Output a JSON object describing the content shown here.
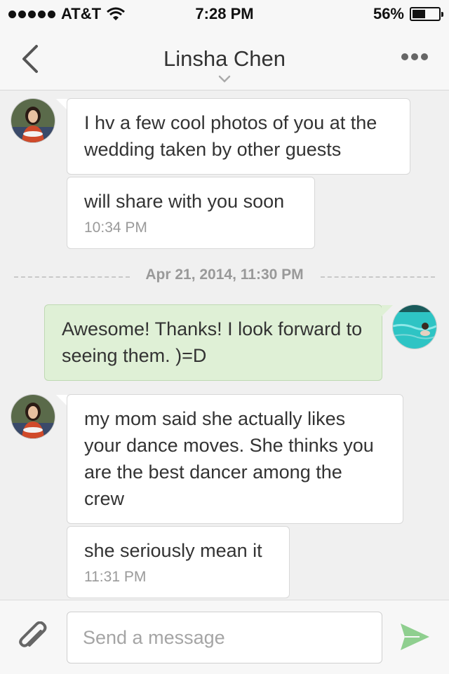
{
  "status_bar": {
    "carrier": "AT&T",
    "time": "7:28 PM",
    "battery_text": "56%",
    "battery_level": 0.56,
    "signal_dots": 5
  },
  "nav": {
    "title": "Linsha Chen",
    "back_icon": "chevron-left-icon",
    "more_icon": "ellipsis-icon",
    "expand_icon": "chevron-down-icon"
  },
  "messages": [
    {
      "direction": "in",
      "text": "I hv a few cool photos of you at the wedding taken by other guests"
    },
    {
      "direction": "in",
      "text": "will share with you soon",
      "time": "10:34 PM"
    },
    {
      "direction": "out",
      "text": "Awesome!  Thanks!  I look forward to seeing them.  )=D"
    },
    {
      "direction": "in",
      "text": "my mom said she actually likes your dance moves. She thinks you are the best dancer among the crew"
    },
    {
      "direction": "in",
      "text": "she seriously mean it",
      "time": "11:31 PM"
    }
  ],
  "date_divider": "Apr 21, 2014, 11:30 PM",
  "composer": {
    "placeholder": "Send a message",
    "value": "",
    "attach_icon": "paperclip-icon",
    "send_icon": "send-icon"
  },
  "colors": {
    "outgoing_bubble": "#dff0d6",
    "incoming_bubble": "#ffffff",
    "send_icon": "#8fcf8f",
    "background": "#f0f0f0"
  }
}
